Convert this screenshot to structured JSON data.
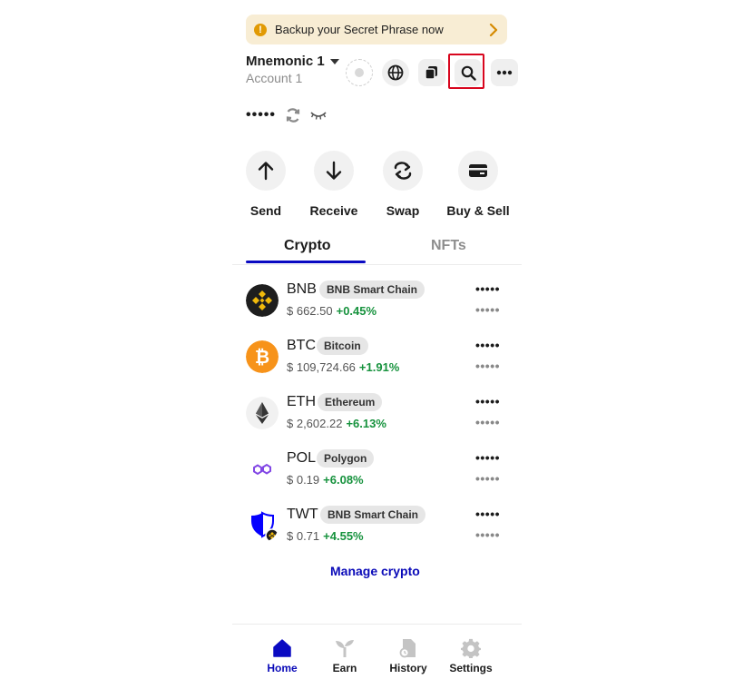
{
  "banner": {
    "text": "Backup your Secret Phrase now",
    "icon": "warning-icon"
  },
  "header": {
    "wallet_name": "Mnemonic 1",
    "account_name": "Account 1",
    "icons": [
      "status-dot-icon",
      "globe-icon",
      "copy-icon",
      "search-icon",
      "more-icon"
    ]
  },
  "balance": {
    "hidden_value": "•••••",
    "icons": [
      "refresh-icon",
      "eye-closed-icon"
    ]
  },
  "actions": [
    {
      "label": "Send",
      "icon": "arrow-up-icon"
    },
    {
      "label": "Receive",
      "icon": "arrow-down-icon"
    },
    {
      "label": "Swap",
      "icon": "swap-icon"
    },
    {
      "label": "Buy & Sell",
      "icon": "card-icon"
    }
  ],
  "tabs": [
    {
      "label": "Crypto",
      "active": true
    },
    {
      "label": "NFTs",
      "active": false
    }
  ],
  "assets": [
    {
      "symbol": "BNB",
      "chain": "BNB Smart Chain",
      "price": "$ 662.50",
      "change": "+0.45%",
      "balance": "•••••",
      "value": "•••••",
      "icon": "bnb-logo-icon"
    },
    {
      "symbol": "BTC",
      "chain": "Bitcoin",
      "price": "$ 109,724.66",
      "change": "+1.91%",
      "balance": "•••••",
      "value": "•••••",
      "icon": "bitcoin-logo-icon"
    },
    {
      "symbol": "ETH",
      "chain": "Ethereum",
      "price": "$ 2,602.22",
      "change": "+6.13%",
      "balance": "•••••",
      "value": "•••••",
      "icon": "ethereum-logo-icon"
    },
    {
      "symbol": "POL",
      "chain": "Polygon",
      "price": "$ 0.19",
      "change": "+6.08%",
      "balance": "•••••",
      "value": "•••••",
      "icon": "polygon-logo-icon"
    },
    {
      "symbol": "TWT",
      "chain": "BNB Smart Chain",
      "price": "$ 0.71",
      "change": "+4.55%",
      "balance": "•••••",
      "value": "•••••",
      "icon": "twt-logo-icon"
    }
  ],
  "manage_label": "Manage crypto",
  "bottom_nav": [
    {
      "label": "Home",
      "active": true,
      "icon": "home-icon"
    },
    {
      "label": "Earn",
      "active": false,
      "icon": "sprout-icon"
    },
    {
      "label": "History",
      "active": false,
      "icon": "history-icon"
    },
    {
      "label": "Settings",
      "active": false,
      "icon": "gear-icon"
    }
  ],
  "colors": {
    "accent": "#0a0ac2",
    "positive": "#16923d",
    "banner_bg": "#f8edd4",
    "warning": "#e19a04",
    "highlight": "#d8061e"
  }
}
